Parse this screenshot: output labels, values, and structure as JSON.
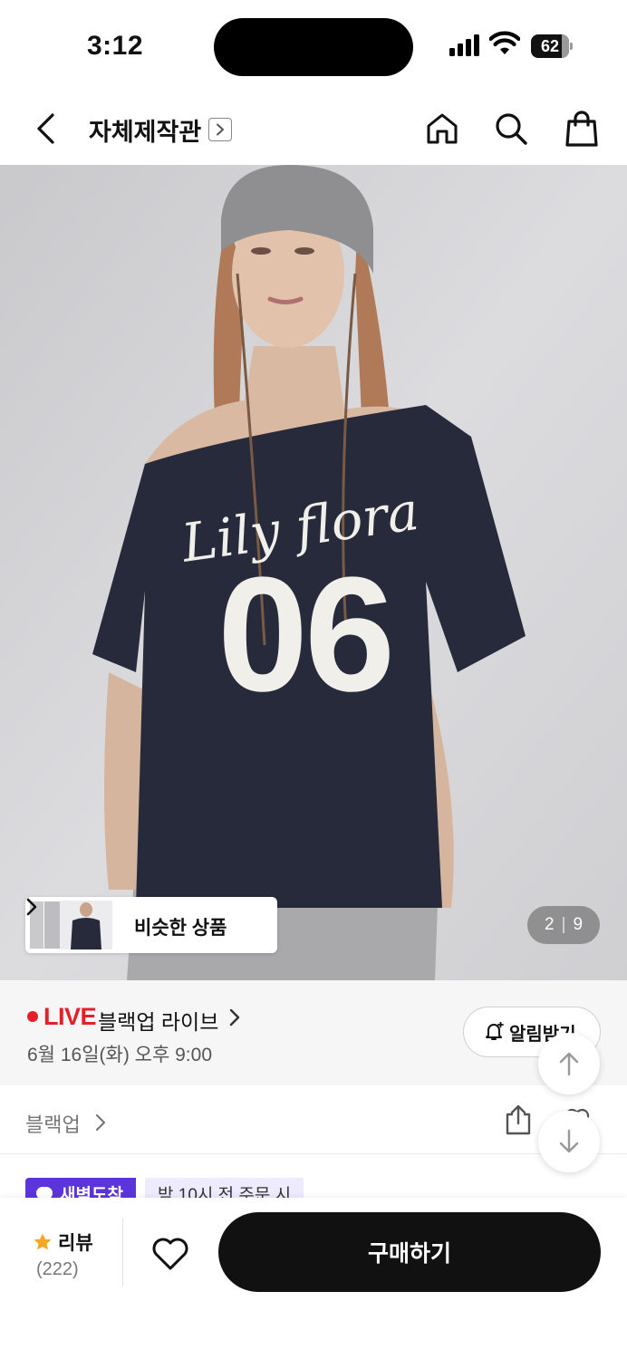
{
  "status_bar": {
    "time": "3:12",
    "battery": "62"
  },
  "header": {
    "store_title": "자체제작관"
  },
  "hero": {
    "shirt_brand_text": "Lily flora",
    "shirt_number": "06",
    "similar_products_label": "비슷한 상품",
    "counter_current": "2",
    "counter_total": "9"
  },
  "live": {
    "tag": "LIVE",
    "title": "블랙업 라이브",
    "date": "6월 16일(화) 오후 9:00",
    "alarm_label": "알림받기"
  },
  "brand": {
    "name": "블랙업"
  },
  "delivery": {
    "badge": "새벽도착",
    "text": "밤 10시 전 주문 시"
  },
  "bottom_bar": {
    "review_label": "리뷰",
    "review_count": "(222)",
    "buy_label": "구매하기"
  },
  "colors": {
    "live_red": "#e5202a",
    "delivery_purple": "#5b35d9",
    "buy_button": "#111111",
    "star": "#f5a623"
  },
  "icons": [
    "back-icon",
    "home-icon",
    "search-icon",
    "shopping-bag-icon",
    "chevron-right-icon",
    "bell-plus-icon",
    "share-icon",
    "arrow-up-icon",
    "arrow-down-icon",
    "star-icon",
    "heart-icon"
  ]
}
